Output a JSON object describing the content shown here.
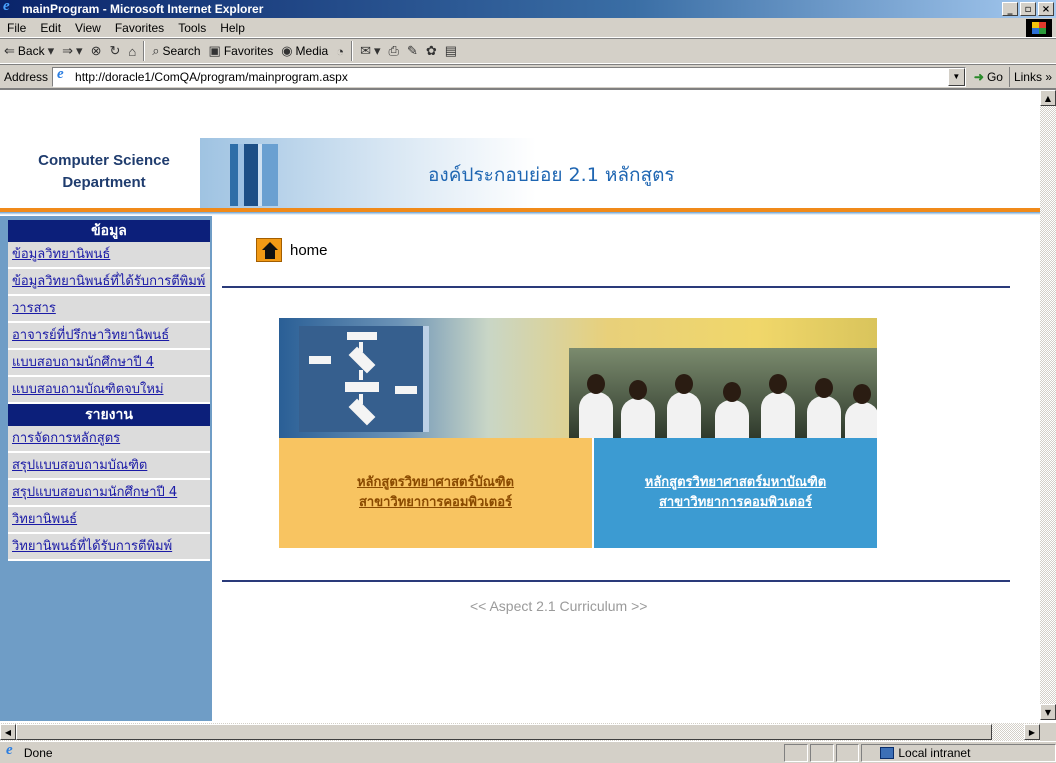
{
  "window": {
    "title": "mainProgram - Microsoft Internet Explorer",
    "controls": [
      "_",
      "▫",
      "×"
    ]
  },
  "menu": [
    "File",
    "Edit",
    "View",
    "Favorites",
    "Tools",
    "Help"
  ],
  "toolbar": {
    "back": "Back",
    "search": "Search",
    "favorites": "Favorites",
    "media": "Media"
  },
  "address": {
    "label": "Address",
    "url": "http://doracle1/ComQA/program/mainprogram.aspx",
    "go": "Go",
    "links": "Links"
  },
  "page": {
    "logo_line1": "Computer Science",
    "logo_line2": "Department",
    "header_title": "องค์ประกอบย่อย 2.1 หลักสูตร",
    "home_label": "home",
    "footer_nav": "<< Aspect 2.1 Curriculum >>"
  },
  "sidebar": {
    "section1_title": "ข้อมูล",
    "section1_items": [
      "ข้อมูลวิทยานิพนธ์",
      "ข้อมูลวิทยานิพนธ์ที่ได้รับการตีพิมพ์",
      "วารสาร",
      "อาจารย์ที่ปรึกษาวิทยานิพนธ์",
      "แบบสอบถามนักศึกษาปี 4",
      "แบบสอบถามบัณฑิตจบใหม่"
    ],
    "section2_title": "รายงาน",
    "section2_items": [
      "การจัดการหลักสูตร",
      "สรุปแบบสอบถามบัณฑิต",
      "สรุปแบบสอบถามนักศึกษาปี 4",
      "วิทยานิพนธ์",
      "วิทยานิพนธ์ที่ได้รับการตีพิมพ์"
    ]
  },
  "programs": {
    "bachelor_line1": "หลักสูตรวิทยาศาสตร์บัณฑิต",
    "bachelor_line2": "สาขาวิทยาการคอมพิวเตอร์",
    "master_line1": "หลักสูตรวิทยาศาสตร์มหาบัณฑิต",
    "master_line2": "สาขาวิทยาการคอมพิวเตอร์"
  },
  "status": {
    "text": "Done",
    "zone": "Local intranet"
  },
  "colors": {
    "header_title": "#1f66b2",
    "sidebar_head": "#0c1f7a",
    "accent_orange": "#f08a1a",
    "card_left": "#f8c461",
    "card_right": "#3c9bd2"
  }
}
